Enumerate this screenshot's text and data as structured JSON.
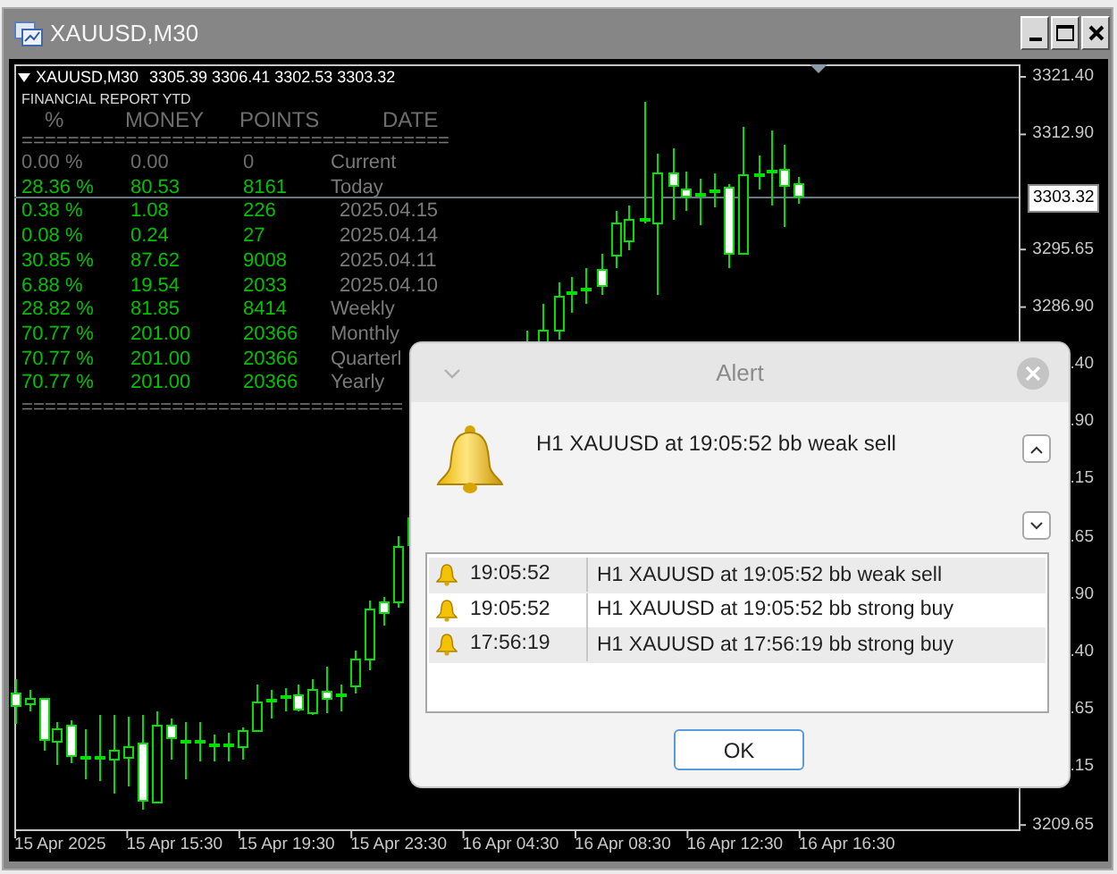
{
  "window": {
    "title": "XAUUSD,M30"
  },
  "chart": {
    "header": {
      "symbol": "XAUUSD,M30",
      "ohlc": "3305.39 3306.41 3302.53 3303.32"
    },
    "report": {
      "title": "FINANCIAL REPORT YTD",
      "columns": [
        "%",
        "MONEY",
        "POINTS",
        "DATE"
      ],
      "rule_top": "=====================================",
      "rows": [
        {
          "kind": "current",
          "percent": "0.00 %",
          "money": "0.00",
          "points": "0",
          "date": "Current"
        },
        {
          "kind": "period",
          "percent": "28.36 %",
          "money": "80.53",
          "points": "8161",
          "date": "Today"
        },
        {
          "kind": "day",
          "percent": "0.38 %",
          "money": "1.08",
          "points": "226",
          "date": "2025.04.15"
        },
        {
          "kind": "day",
          "percent": "0.08 %",
          "money": "0.24",
          "points": "27",
          "date": "2025.04.14"
        },
        {
          "kind": "day",
          "percent": "30.85 %",
          "money": "87.62",
          "points": "9008",
          "date": "2025.04.11"
        },
        {
          "kind": "day",
          "percent": "6.88 %",
          "money": "19.54",
          "points": "2033",
          "date": "2025.04.10"
        },
        {
          "kind": "period",
          "percent": "28.82 %",
          "money": "81.85",
          "points": "8414",
          "date": "Weekly"
        },
        {
          "kind": "period",
          "percent": "70.77 %",
          "money": "201.00",
          "points": "20366",
          "date": "Monthly"
        },
        {
          "kind": "period",
          "percent": "70.77 %",
          "money": "201.00",
          "points": "20366",
          "date": "Quarterl"
        },
        {
          "kind": "period",
          "percent": "70.77 %",
          "money": "201.00",
          "points": "20366",
          "date": "Yearly"
        }
      ],
      "rule_bottom": "================================="
    },
    "price_axis": [
      "3321.40",
      "3312.90",
      "3295.65",
      "3286.90",
      ".40",
      ".90",
      ".15",
      ".65",
      ".90",
      ".40",
      ".65",
      ".15",
      "3209.65"
    ],
    "current_price": "3303.32",
    "time_axis": [
      "15 Apr 2025",
      "15 Apr 15:30",
      "15 Apr 19:30",
      "15 Apr 23:30",
      "16 Apr 04:30",
      "16 Apr 08:30",
      "16 Apr 12:30",
      "16 Apr 16:30"
    ]
  },
  "alert": {
    "title": "Alert",
    "message": "H1 XAUUSD at 19:05:52 bb weak sell",
    "list": [
      {
        "time": "19:05:52",
        "message": "H1 XAUUSD at 19:05:52 bb weak sell"
      },
      {
        "time": "19:05:52",
        "message": "H1 XAUUSD at 19:05:52 bb strong buy"
      },
      {
        "time": "17:56:19",
        "message": "H1 XAUUSD at 17:56:19 bb strong buy"
      }
    ],
    "ok": "OK"
  }
}
